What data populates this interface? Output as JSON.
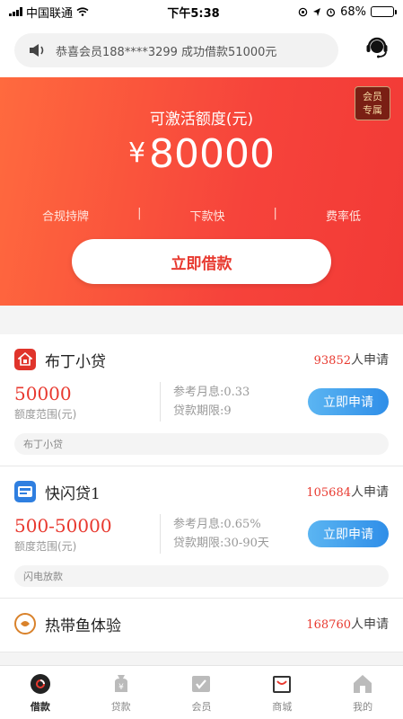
{
  "status_bar": {
    "carrier": "中国联通",
    "time": "下午5:38",
    "battery": "68%",
    "battery_level": 0.68
  },
  "notice": {
    "text": "恭喜会员188****3299 成功借款51000元"
  },
  "hero": {
    "title": "可激活额度(元)",
    "currency": "¥",
    "amount": "80000",
    "badge_line1": "会员",
    "badge_line2": "专属",
    "features": [
      "合规持牌",
      "下款快",
      "费率低"
    ],
    "cta": "立即借款"
  },
  "loans": [
    {
      "name": "布丁小贷",
      "count": "93852",
      "count_suffix": "人申请",
      "amount": "50000",
      "amount_label": "额度范围(元)",
      "rate": "参考月息:0.33",
      "term": "贷款期限:9",
      "button": "立即申请",
      "tag": "布丁小贷"
    },
    {
      "name": "快闪贷1",
      "count": "105684",
      "count_suffix": "人申请",
      "amount": "500-50000",
      "amount_label": "额度范围(元)",
      "rate": "参考月息:0.65%",
      "term": "贷款期限:30-90天",
      "button": "立即申请",
      "tag": "闪电放款"
    },
    {
      "name": "热带鱼体验",
      "count": "168760",
      "count_suffix": "人申请"
    }
  ],
  "tabbar": [
    {
      "label": "借款",
      "icon": "loan-disc-icon",
      "active": true
    },
    {
      "label": "贷款",
      "icon": "money-bag-icon",
      "active": false
    },
    {
      "label": "会员",
      "icon": "member-card-icon",
      "active": false
    },
    {
      "label": "商城",
      "icon": "shopping-bag-icon",
      "active": false
    },
    {
      "label": "我的",
      "icon": "home-icon",
      "active": false
    }
  ],
  "colors": {
    "accent": "#e8392f",
    "hero_start": "#ff6a3e",
    "hero_end": "#f23a36",
    "button_blue": "#2f8ee8"
  }
}
